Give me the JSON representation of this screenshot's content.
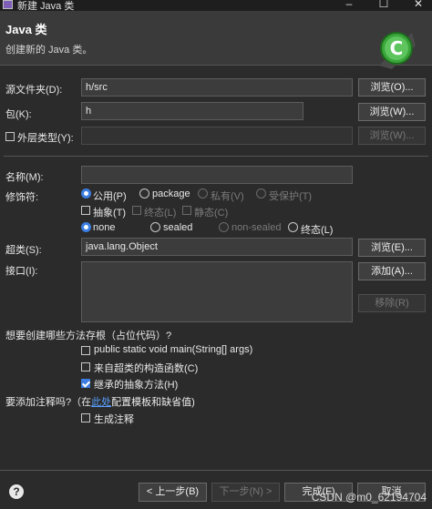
{
  "window": {
    "title": "新建 Java 类",
    "minimize": "–",
    "maximize": "☐",
    "close": "✕"
  },
  "header": {
    "title": "Java 类",
    "subtitle": "创建新的 Java 类。"
  },
  "form": {
    "source_folder": {
      "label": "源文件夹(D):",
      "value": "h/src",
      "button": "浏览(O)..."
    },
    "package": {
      "label": "包(K):",
      "value": "h",
      "button": "浏览(W)..."
    },
    "enclosing_type": {
      "label": "外层类型(Y):",
      "value": "",
      "button": "浏览(W)..."
    },
    "name": {
      "label": "名称(M):",
      "value": ""
    },
    "modifiers": {
      "label": "修饰符:",
      "access": [
        "公用(P)",
        "package",
        "私有(V)",
        "受保护(T)"
      ],
      "checks": [
        "抽象(T)",
        "终态(L)",
        "静态(C)"
      ],
      "kind": [
        "none",
        "sealed",
        "non-sealed",
        "终态(L)"
      ]
    },
    "superclass": {
      "label": "超类(S):",
      "value": "java.lang.Object",
      "button": "浏览(E)..."
    },
    "interfaces": {
      "label": "接口(I):",
      "add": "添加(A)...",
      "remove": "移除(R)"
    },
    "stubs": {
      "question": "想要创建哪些方法存根（占位代码）?",
      "items": [
        "public static void main(String[] args)",
        "来自超类的构造函数(C)",
        "继承的抽象方法(H)"
      ]
    },
    "comments": {
      "question_pre": "要添加注释吗?（在",
      "link": "此处",
      "question_post": "配置模板和缺省值)",
      "item": "生成注释"
    }
  },
  "footer": {
    "back": "< 上一步(B)",
    "next": "下一步(N) >",
    "finish": "完成(F)",
    "cancel": "取消",
    "help": "?"
  },
  "watermark": "CSDN @m0_62194704"
}
